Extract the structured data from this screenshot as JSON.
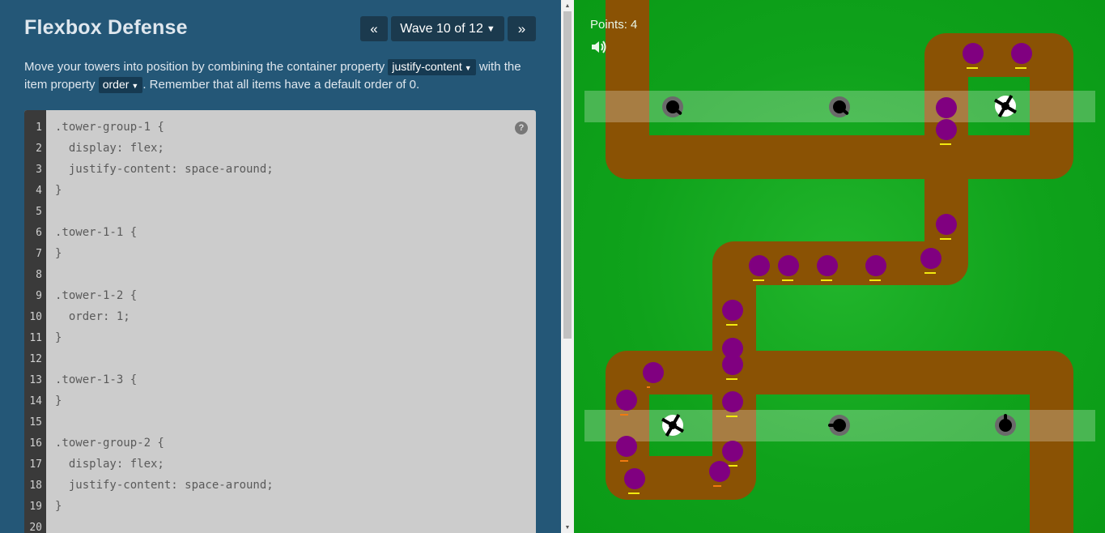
{
  "header": {
    "title": "Flexbox Defense",
    "prev_label": "«",
    "wave_label": "Wave 10 of 12",
    "next_label": "»"
  },
  "instructions": {
    "part1": "Move your towers into position by combining the container property ",
    "prop1": "justify-content",
    "part2": " with the item property ",
    "prop2": "order",
    "part3": ". Remember that all items have a default order of 0."
  },
  "editor": {
    "help_label": "?",
    "lines": [
      {
        "n": "1",
        "text": ".tower-group-1 {"
      },
      {
        "n": "2",
        "text": "  display: flex;"
      },
      {
        "n": "3",
        "text": "  justify-content: space-around;"
      },
      {
        "n": "4",
        "text": "}"
      },
      {
        "n": "5",
        "text": ""
      },
      {
        "n": "6",
        "text": ".tower-1-1 {"
      },
      {
        "n": "7",
        "text": "}"
      },
      {
        "n": "8",
        "text": ""
      },
      {
        "n": "9",
        "text": ".tower-1-2 {"
      },
      {
        "n": "10",
        "text": "  order: 1;"
      },
      {
        "n": "11",
        "text": "}"
      },
      {
        "n": "12",
        "text": ""
      },
      {
        "n": "13",
        "text": ".tower-1-3 {"
      },
      {
        "n": "14",
        "text": "}"
      },
      {
        "n": "15",
        "text": ""
      },
      {
        "n": "16",
        "text": ".tower-group-2 {"
      },
      {
        "n": "17",
        "text": "  display: flex;"
      },
      {
        "n": "18",
        "text": "  justify-content: space-around;"
      },
      {
        "n": "19",
        "text": "}"
      },
      {
        "n": "20",
        "text": ""
      }
    ]
  },
  "game": {
    "points_label": "Points: 4",
    "sound_icon": "speaker-icon",
    "colors": {
      "grass": "#11a51d",
      "path": "#8a5204",
      "enemy": "#800080",
      "health_bar": "#f2ea10",
      "health_low": "#f07a10",
      "tower_base": "#6a6a6a",
      "tower_zone": "rgba(255,255,255,0.25)"
    }
  }
}
